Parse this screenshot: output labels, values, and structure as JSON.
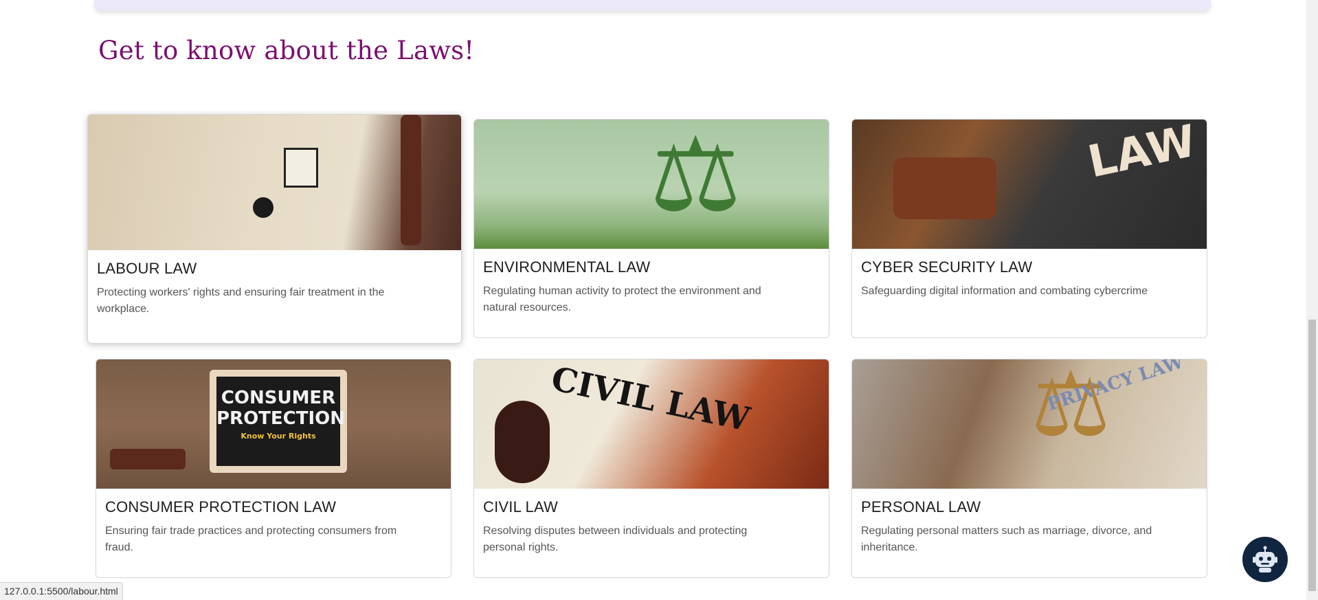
{
  "section": {
    "title": "Get to know about the Laws!"
  },
  "cards": [
    {
      "title": "LABOUR LAW",
      "text": "Protecting workers' rights and ensuring fair treatment in the workplace."
    },
    {
      "title": "ENVIRONMENTAL LAW",
      "text": "Regulating human activity to protect the environment and natural resources."
    },
    {
      "title": "CYBER SECURITY LAW",
      "text": "Safeguarding digital information and combating cybercrime"
    },
    {
      "title": "CONSUMER PROTECTION LAW",
      "text": "Ensuring fair trade practices and protecting consumers from fraud."
    },
    {
      "title": "CIVIL LAW",
      "text": "Resolving disputes between individuals and protecting personal rights."
    },
    {
      "title": "PERSONAL LAW",
      "text": "Regulating personal matters such as marriage, divorce, and inheritance."
    }
  ],
  "images": {
    "consumer_line1": "CONSUMER",
    "consumer_line2": "PROTECTION",
    "consumer_line3": "Know Your Rights",
    "civil_word": "CIVIL LAW",
    "cyber_word": "LAW",
    "privacy_word": "PRIVACY LAW"
  },
  "status_bar": {
    "url": "127.0.0.1:5500/labour.html"
  },
  "icons": {
    "chatbot": "robot-icon"
  },
  "colors": {
    "title": "#7b1070",
    "chatbot_bg": "#0f2540"
  }
}
